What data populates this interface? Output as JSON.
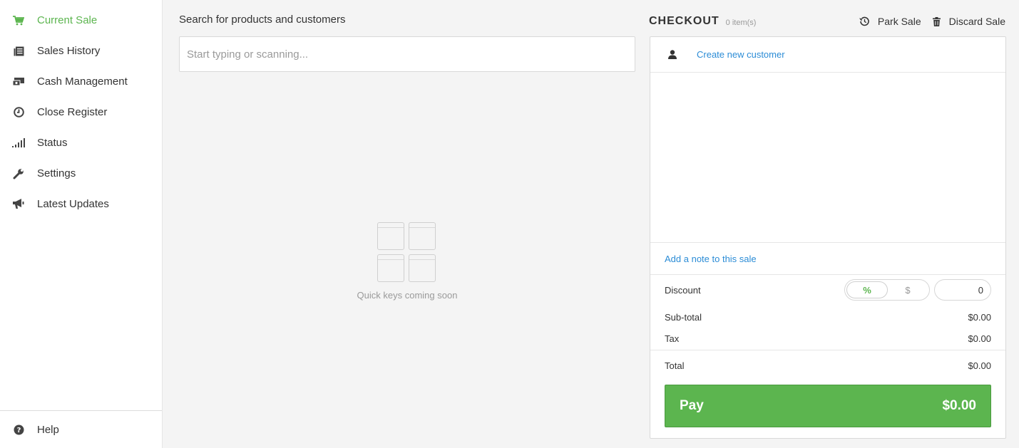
{
  "sidebar": {
    "items": [
      {
        "label": "Current Sale",
        "icon": "cart-icon"
      },
      {
        "label": "Sales History",
        "icon": "history-list-icon"
      },
      {
        "label": "Cash Management",
        "icon": "cash-icon"
      },
      {
        "label": "Close Register",
        "icon": "clock-icon"
      },
      {
        "label": "Status",
        "icon": "signal-bars-icon"
      },
      {
        "label": "Settings",
        "icon": "wrench-icon"
      },
      {
        "label": "Latest Updates",
        "icon": "megaphone-icon"
      }
    ],
    "footer": {
      "label": "Help",
      "icon": "help-icon"
    }
  },
  "search": {
    "title": "Search for products and customers",
    "placeholder": "Start typing or scanning...",
    "value": ""
  },
  "quickkeys": {
    "text": "Quick keys coming soon"
  },
  "checkout": {
    "title": "CHECKOUT",
    "count": "0 item(s)",
    "park_label": "Park Sale",
    "discard_label": "Discard Sale",
    "create_customer": "Create new customer",
    "add_note": "Add a note to this sale",
    "discount_label": "Discount",
    "discount_percent": "%",
    "discount_dollar": "$",
    "discount_value": "0",
    "subtotal_label": "Sub-total",
    "subtotal_value": "$0.00",
    "tax_label": "Tax",
    "tax_value": "$0.00",
    "total_label": "Total",
    "total_value": "$0.00",
    "pay_label": "Pay",
    "pay_amount": "$0.00"
  },
  "colors": {
    "accent": "#5cb54f",
    "link": "#2b8cd6"
  }
}
